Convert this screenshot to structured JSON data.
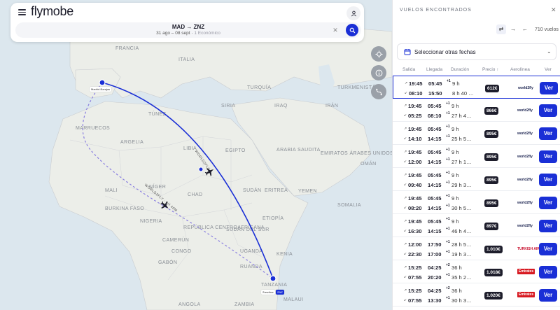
{
  "header": {
    "logo": "flymobe",
    "route_title": "MAD → ZNZ",
    "route_dates": "31 ago – 08 sept",
    "route_class": "1 Económico"
  },
  "icons": {
    "menu": "menu-icon",
    "user": "user-icon",
    "search": "search-icon",
    "clear": "close-icon",
    "locate": "locate-icon",
    "info": "info-icon",
    "route": "route-icon"
  },
  "colors": {
    "accent": "#1a2fd6",
    "route_line": "#1a2fd6",
    "route_dashed": "#8a7fe0",
    "price_bg": "#1d1d2b"
  },
  "map": {
    "labels": [
      "FRANCIA",
      "ITALIA",
      "TURQUÍA",
      "TURKMENISTÁN",
      "SIRIA",
      "IRAQ",
      "IRÁN",
      "TÚNEZ",
      "MARRUECOS",
      "ARGELIA",
      "LIBIA",
      "EGIPTO",
      "ARABIA SAUDITA",
      "EMIRATOS ÁRABES UNIDOS",
      "OMÁN",
      "YEMEN",
      "MALI",
      "NÍGER",
      "CHAD",
      "SUDÁN",
      "ERITREA",
      "ETIOPÍA",
      "SOMALIA",
      "BURKINA FASO",
      "NIGERIA",
      "REPÚBLICA CENTROAFRICANA",
      "SUDÁN DEL SUR",
      "CAMERÚN",
      "GABÓN",
      "CONGO",
      "UGANDA",
      "KENIA",
      "RUANDA",
      "TANZANIA",
      "ANGOLA",
      "ZAMBIA",
      "MALAUI"
    ],
    "origin_label": "Madrid-Barajas",
    "destination_label": "Zanzíbar",
    "destination_code": "ZNZ",
    "route_labels": [
      "WORLD2FLY",
      "WORLD2FLY · 9h 40m"
    ]
  },
  "panel": {
    "title": "VUELOS ENCONTRADOS",
    "count": "710 vuelos",
    "date_button": "Seleccionar otras fechas",
    "columns": [
      "Salida",
      "Llegada",
      "Duración",
      "Precio ↑",
      "Aerolínea",
      "Ver"
    ],
    "ver_label": "Ver",
    "flights": [
      {
        "price": "612€",
        "airline": "world2fly",
        "airline_style": "wf",
        "selected": true,
        "legs": [
          {
            "dir": "↗",
            "dep": "19:45",
            "arr": "05:45",
            "plus": "+1",
            "dur": "9 h"
          },
          {
            "dir": "↙",
            "dep": "08:10",
            "arr": "15:50",
            "plus": "",
            "dur": "8 h 40 …"
          }
        ]
      },
      {
        "price": "866€",
        "airline": "world2fly",
        "airline_style": "wf",
        "selected": false,
        "legs": [
          {
            "dir": "↗",
            "dep": "19:45",
            "arr": "05:45",
            "plus": "+1",
            "dur": "9 h"
          },
          {
            "dir": "↙",
            "dep": "05:25",
            "arr": "08:10",
            "plus": "+1",
            "dur": "27 h 4…"
          }
        ]
      },
      {
        "price": "895€",
        "airline": "world2fly",
        "airline_style": "wf",
        "selected": false,
        "legs": [
          {
            "dir": "↗",
            "dep": "19:45",
            "arr": "05:45",
            "plus": "+1",
            "dur": "9 h"
          },
          {
            "dir": "↙",
            "dep": "14:10",
            "arr": "14:15",
            "plus": "+1",
            "dur": "25 h 5…"
          }
        ]
      },
      {
        "price": "895€",
        "airline": "world2fly",
        "airline_style": "wf",
        "selected": false,
        "legs": [
          {
            "dir": "↗",
            "dep": "19:45",
            "arr": "05:45",
            "plus": "+1",
            "dur": "9 h"
          },
          {
            "dir": "↙",
            "dep": "12:00",
            "arr": "14:15",
            "plus": "+1",
            "dur": "27 h 1…"
          }
        ]
      },
      {
        "price": "895€",
        "airline": "world2fly",
        "airline_style": "wf",
        "selected": false,
        "legs": [
          {
            "dir": "↗",
            "dep": "19:45",
            "arr": "05:45",
            "plus": "+1",
            "dur": "9 h"
          },
          {
            "dir": "↙",
            "dep": "09:40",
            "arr": "14:15",
            "plus": "+1",
            "dur": "29 h 3…"
          }
        ]
      },
      {
        "price": "895€",
        "airline": "world2fly",
        "airline_style": "wf",
        "selected": false,
        "legs": [
          {
            "dir": "↗",
            "dep": "19:45",
            "arr": "05:45",
            "plus": "+1",
            "dur": "9 h"
          },
          {
            "dir": "↙",
            "dep": "08:20",
            "arr": "14:15",
            "plus": "+1",
            "dur": "30 h 5…"
          }
        ]
      },
      {
        "price": "897€",
        "airline": "world2fly",
        "airline_style": "wf",
        "selected": false,
        "legs": [
          {
            "dir": "↗",
            "dep": "19:45",
            "arr": "05:45",
            "plus": "+1",
            "dur": "9 h"
          },
          {
            "dir": "↙",
            "dep": "16:30",
            "arr": "14:15",
            "plus": "+1",
            "dur": "46 h 4…"
          }
        ]
      },
      {
        "price": "1.010€",
        "airline": "TURKISH AIRLINES",
        "airline_style": "tk",
        "selected": false,
        "legs": [
          {
            "dir": "↗",
            "dep": "12:00",
            "arr": "17:50",
            "plus": "+1",
            "dur": "28 h 5…"
          },
          {
            "dir": "↙",
            "dep": "22:30",
            "arr": "17:00",
            "plus": "+1",
            "dur": "19 h 3…"
          }
        ]
      },
      {
        "price": "1.018€",
        "airline": "Emirates",
        "airline_style": "ek",
        "selected": false,
        "legs": [
          {
            "dir": "↗",
            "dep": "15:25",
            "arr": "04:25",
            "plus": "+2",
            "dur": "36 h"
          },
          {
            "dir": "↙",
            "dep": "07:55",
            "arr": "20:20",
            "plus": "+1",
            "dur": "35 h 2…"
          }
        ]
      },
      {
        "price": "1.020€",
        "airline": "Emirates",
        "airline_style": "ek",
        "selected": false,
        "legs": [
          {
            "dir": "↗",
            "dep": "15:25",
            "arr": "04:25",
            "plus": "+2",
            "dur": "36 h"
          },
          {
            "dir": "↙",
            "dep": "07:55",
            "arr": "13:30",
            "plus": "+1",
            "dur": "30 h 3…"
          }
        ]
      }
    ]
  }
}
